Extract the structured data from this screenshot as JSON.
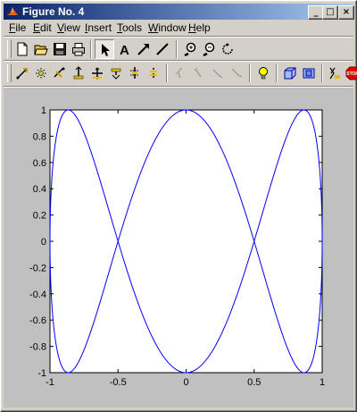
{
  "window": {
    "title": "Figure No. 4"
  },
  "title_buttons": {
    "minimize": "_",
    "maximize": "□",
    "close": "×"
  },
  "menu": [
    {
      "label": "File",
      "u": "F",
      "rest": "ile"
    },
    {
      "label": "Edit",
      "u": "E",
      "rest": "dit"
    },
    {
      "label": "View",
      "u": "V",
      "rest": "iew"
    },
    {
      "label": "Insert",
      "u": "I",
      "rest": "nsert"
    },
    {
      "label": "Tools",
      "u": "T",
      "rest": "ools"
    },
    {
      "label": "Window",
      "u": "W",
      "rest": "indow"
    },
    {
      "label": "Help",
      "u": "H",
      "rest": "elp"
    }
  ],
  "toolbar1": [
    "new-figure-icon",
    "open-file-icon",
    "save-icon",
    "print-icon",
    "select-arrow-icon",
    "insert-text-icon",
    "insert-arrow-icon",
    "insert-line-icon",
    "zoom-in-icon",
    "zoom-out-icon",
    "rotate-3d-icon"
  ],
  "toolbar2": [
    "camera-orbit-icon",
    "orbit-light-icon",
    "pan-tilt-icon",
    "move-camera-icon",
    "move-forward-icon",
    "move-camera-up-icon",
    "roll-camera-icon",
    "principal-axis-icon",
    "light-toggle-icon",
    "projection-icon",
    "reset-icon",
    "stop-icon"
  ],
  "colors": {
    "curve": "#0000ff",
    "figure_bg": "#c0c0c0",
    "axes_bg": "#ffffff"
  },
  "chart_data": {
    "type": "line",
    "title": "",
    "xlabel": "",
    "ylabel": "",
    "xlim": [
      -1,
      1
    ],
    "ylim": [
      -1,
      1
    ],
    "xticks": [
      "-1",
      "-0.5",
      "0",
      "0.5",
      "1"
    ],
    "yticks": [
      "1",
      "0.8",
      "0.6",
      "0.4",
      "0.2",
      "0",
      "-0.2",
      "-0.4",
      "-0.6",
      "-0.8",
      "-1"
    ],
    "xtick_values": [
      -1,
      -0.5,
      0,
      0.5,
      1
    ],
    "ytick_values": [
      1,
      0.8,
      0.6,
      0.4,
      0.2,
      0,
      -0.2,
      -0.4,
      -0.6,
      -0.8,
      -1
    ],
    "grid": false,
    "series": [
      {
        "values_description_x": "sin(t)",
        "values_description_y": "cos(3t)",
        "x": [
          0,
          0.259,
          0.5,
          0.707,
          0.866,
          0.966,
          1,
          0.966,
          0.866,
          0.707,
          0.5,
          0.259,
          0,
          -0.259,
          -0.5,
          -0.707,
          -0.866,
          -0.966,
          -1,
          -0.966,
          -0.866,
          -0.707,
          -0.5,
          -0.259,
          0
        ],
        "y": [
          1,
          0.707,
          0,
          -0.707,
          -1,
          -0.707,
          0,
          0.707,
          1,
          0.707,
          0,
          -0.707,
          -1,
          -0.707,
          0,
          0.707,
          1,
          0.707,
          0,
          -0.707,
          -1,
          -0.707,
          0,
          0.707,
          1
        ]
      }
    ]
  }
}
